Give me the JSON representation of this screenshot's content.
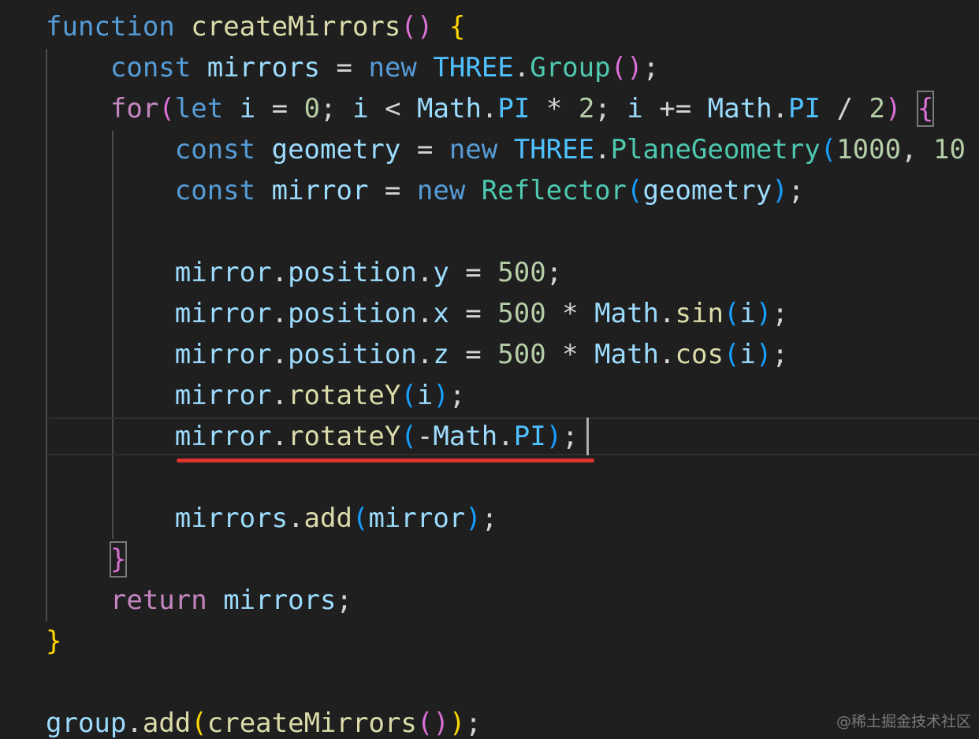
{
  "tokens": {
    "t1": "function",
    "t2": "createMirrors",
    "t3": "(",
    "t4": ")",
    "t5": "{",
    "t6": "const",
    "t7": "mirrors",
    "t8": "=",
    "t9": "new",
    "t10": "THREE",
    "t11": ".",
    "t12": "Group",
    "t13": "(",
    "t14": ")",
    "t15": ";",
    "t16": "for",
    "t17": "(",
    "t18": "let",
    "t19": "i",
    "t20": "=",
    "t21": "0",
    "t22": ";",
    "t23": "i",
    "t24": "<",
    "t25": "Math",
    "t26": ".",
    "t27": "PI",
    "t28": "*",
    "t29": "2",
    "t30": ";",
    "t31": "i",
    "t32": "+=",
    "t33": "Math",
    "t34": ".",
    "t35": "PI",
    "t36": "/",
    "t37": "2",
    "t38": ")",
    "t39": "{",
    "t40": "const",
    "t41": "geometry",
    "t42": "=",
    "t43": "new",
    "t44": "THREE",
    "t45": ".",
    "t46": "PlaneGeometry",
    "t47": "(",
    "t48": "1000",
    "t49": ",",
    "t50": "10",
    "t51": "const",
    "t52": "mirror",
    "t53": "=",
    "t54": "new",
    "t55": "Reflector",
    "t56": "(",
    "t57": "geometry",
    "t58": ")",
    "t59": ";",
    "t60": "mirror",
    "t61": ".",
    "t62": "position",
    "t63": ".",
    "t64": "y",
    "t65": "=",
    "t66": "500",
    "t67": ";",
    "t68": "mirror",
    "t69": ".",
    "t70": "position",
    "t71": ".",
    "t72": "x",
    "t73": "=",
    "t74": "500",
    "t75": "*",
    "t76": "Math",
    "t77": ".",
    "t78": "sin",
    "t79": "(",
    "t80": "i",
    "t81": ")",
    "t82": ";",
    "t83": "mirror",
    "t84": ".",
    "t85": "position",
    "t86": ".",
    "t87": "z",
    "t88": "=",
    "t89": "500",
    "t90": "*",
    "t91": "Math",
    "t92": ".",
    "t93": "cos",
    "t94": "(",
    "t95": "i",
    "t96": ")",
    "t97": ";",
    "t98": "mirror",
    "t99": ".",
    "t100": "rotateY",
    "t101": "(",
    "t102": "i",
    "t103": ")",
    "t104": ";",
    "t105": "mirror",
    "t106": ".",
    "t107": "rotateY",
    "t108": "(",
    "t109": "-",
    "t110": "Math",
    "t111": ".",
    "t112": "PI",
    "t113": ")",
    "t114": ";",
    "t115": "mirrors",
    "t116": ".",
    "t117": "add",
    "t118": "(",
    "t119": "mirror",
    "t120": ")",
    "t121": ";",
    "t122": "}",
    "t123": "return",
    "t124": "mirrors",
    "t125": ";",
    "t126": "}",
    "t127": "group",
    "t128": ".",
    "t129": "add",
    "t130": "(",
    "t131": "createMirrors",
    "t132": "(",
    "t133": ")",
    "t134": ")",
    "t135": ";"
  },
  "watermark": "@稀土掘金技术社区",
  "colors": {
    "background": "#1f1f1f",
    "keyword": "#569cd6",
    "control": "#c586c0",
    "function": "#dcdcaa",
    "variable": "#9cdcfe",
    "constant": "#4fc1ff",
    "type": "#4ec9b0",
    "number": "#b5cea8",
    "bracket_level_1": "#ffd700",
    "bracket_level_2": "#da70d6",
    "bracket_level_3": "#179fff",
    "annotation_underline": "#e0332a"
  }
}
